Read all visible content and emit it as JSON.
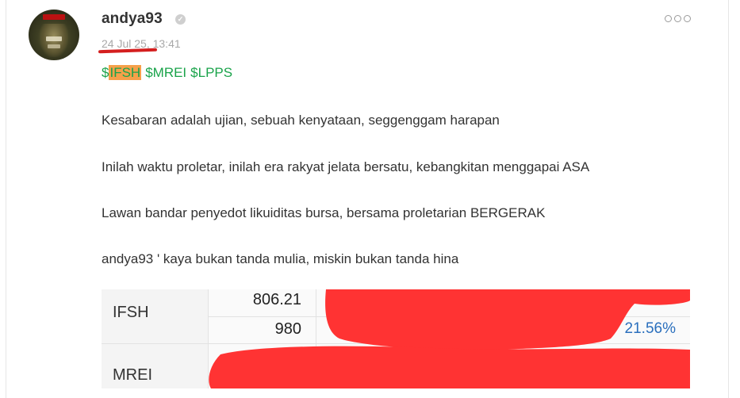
{
  "post": {
    "username": "andya93",
    "verified_icon": "check-badge-icon",
    "date": "24 Jul 25",
    "time": ", 13:41",
    "more_icon": "more-dots-icon",
    "tickers": [
      "$IFSH",
      "$MREI",
      "$LPPS"
    ],
    "highlight_color": "#f5a04a",
    "ticker_color": "#1aa34a",
    "lines": [
      "Kesabaran adalah ujian, sebuah kenyataan, seggenggam harapan",
      "Inilah waktu proletar, inilah era rakyat jelata bersatu, kebangkitan menggapai ASA",
      "Lawan bandar penyedot likuiditas bursa, bersama proletarian BERGERAK",
      "andya93 ' kaya bukan tanda mulia, miskin bukan tanda hina"
    ]
  },
  "table": {
    "rows": [
      {
        "name": "IFSH",
        "value1": "806.21",
        "value2": "980",
        "pct": "21.56%"
      },
      {
        "name": "MREI"
      }
    ],
    "pct_color": "#2a6fbd",
    "redaction_color": "#ff3333"
  }
}
